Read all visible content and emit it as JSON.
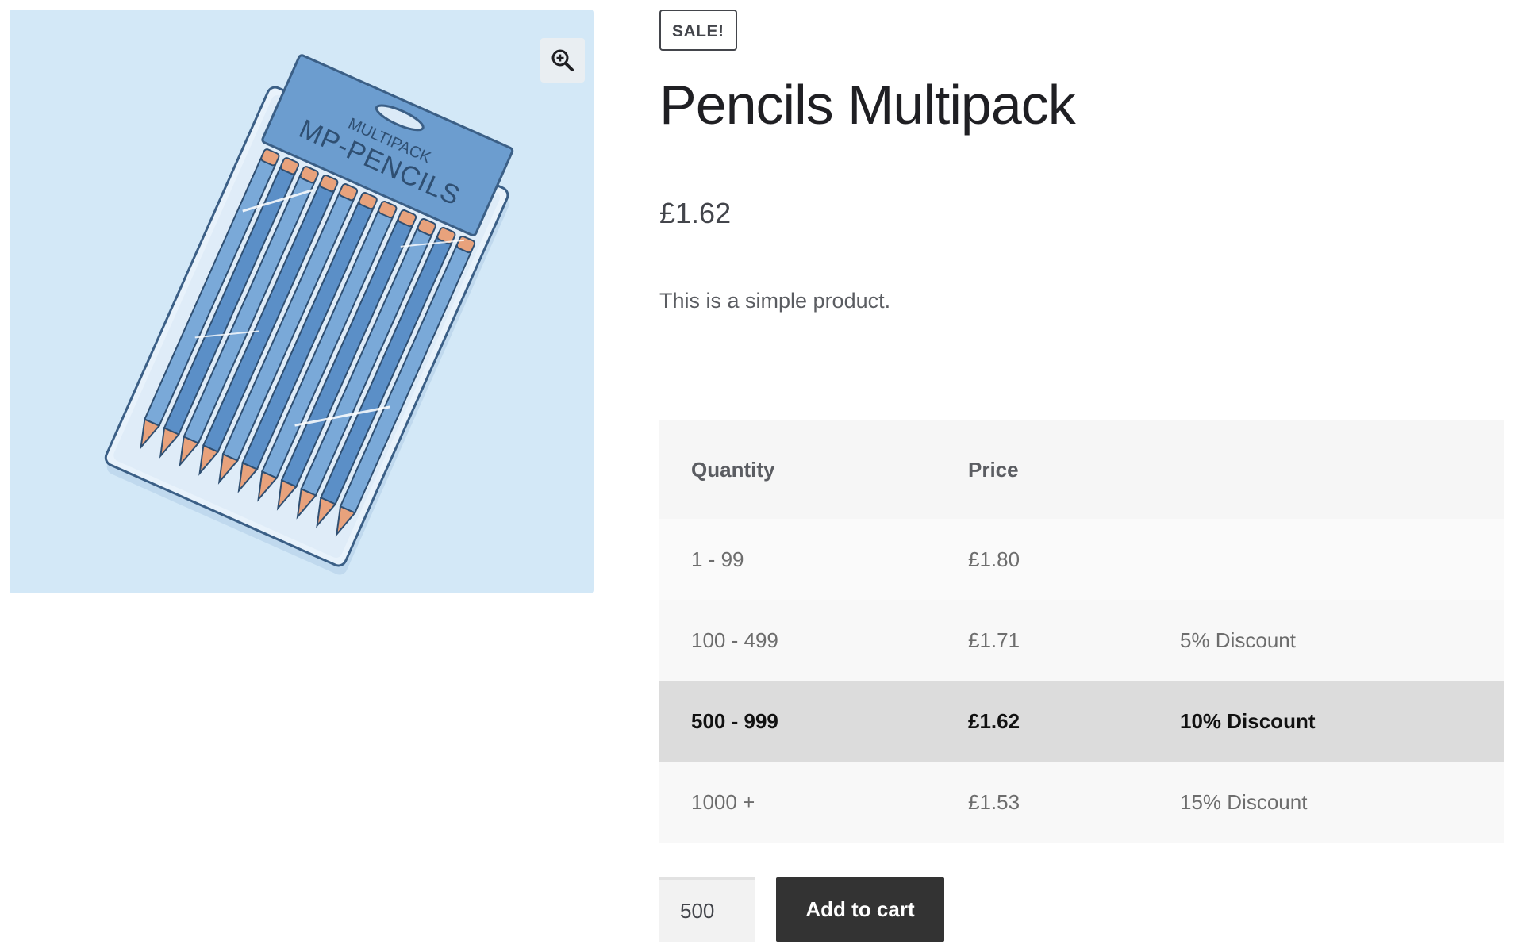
{
  "gallery": {
    "image_alt": "Pencils Multipack product image",
    "packaging_lines": [
      "MULTIPACK",
      "MP-PENCILS"
    ],
    "zoom_icon": "zoom-in-icon",
    "background_color": "#d3e8f7"
  },
  "badge": {
    "label": "SALE!"
  },
  "product": {
    "title": "Pencils Multipack",
    "price": "£1.62",
    "description": "This is a simple product."
  },
  "tiers": {
    "headers": {
      "quantity": "Quantity",
      "price": "Price",
      "discount": ""
    },
    "rows": [
      {
        "quantity": "1 - 99",
        "price": "£1.80",
        "discount": "",
        "active": false
      },
      {
        "quantity": "100 - 499",
        "price": "£1.71",
        "discount": "5% Discount",
        "active": false
      },
      {
        "quantity": "500 - 999",
        "price": "£1.62",
        "discount": "10% Discount",
        "active": true
      },
      {
        "quantity": "1000 +",
        "price": "£1.53",
        "discount": "15% Discount",
        "active": false
      }
    ]
  },
  "cart": {
    "quantity_value": "500",
    "add_label": "Add to cart"
  },
  "colors": {
    "button_bg": "#333333",
    "active_row_bg": "#dcdcdc",
    "pencil_blue": "#5b8fc7",
    "pencil_tip": "#e8a27c"
  }
}
